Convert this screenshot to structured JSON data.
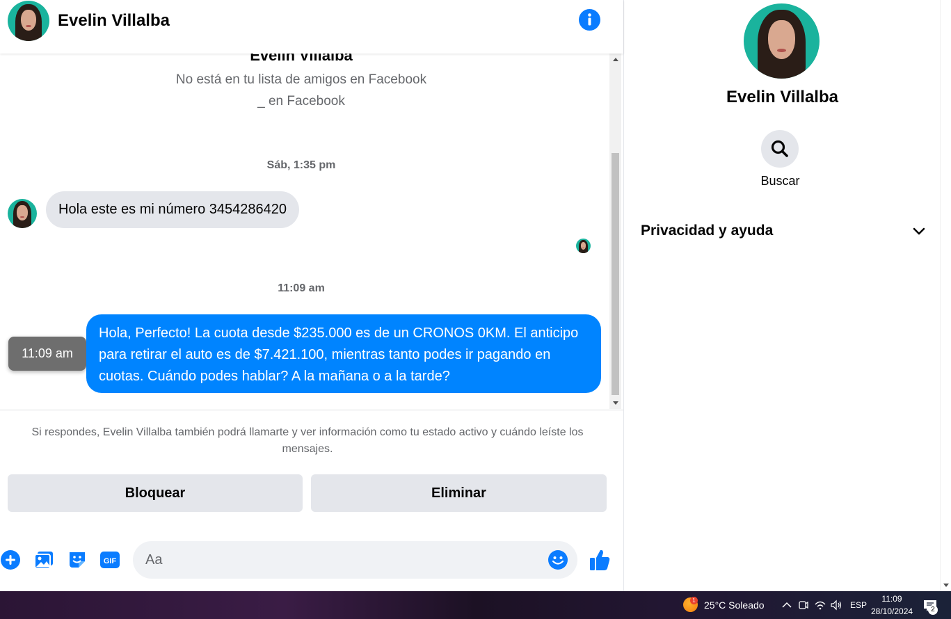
{
  "contact": {
    "name": "Evelin Villalba"
  },
  "intro": {
    "name": "Evelin Villalba",
    "line1": "No está en tu lista de amigos en Facebook",
    "line2": "_ en Facebook"
  },
  "messages": [
    {
      "timestamp": "Sáb, 1:35 pm",
      "direction": "incoming",
      "text": "Hola este es mi número 3454286420"
    },
    {
      "timestamp": "11:09 am",
      "direction": "outgoing",
      "text": "Hola, Perfecto! La cuota desde $235.000 es de un CRONOS 0KM. El anticipo para retirar el auto es de $7.421.100, mientras tanto podes ir pagando en cuotas. Cuándo podes hablar? A la mañana o a la tarde?",
      "tooltip": "11:09 am"
    }
  ],
  "notice": "Si respondes, Evelin Villalba también podrá llamarte y ver información como tu estado activo y cuándo leíste los mensajes.",
  "actions": {
    "block": "Bloquear",
    "delete": "Eliminar"
  },
  "composer": {
    "placeholder": "Aa",
    "icons": [
      "plus-icon",
      "photo-icon",
      "sticker-icon",
      "gif-icon",
      "emoji-icon",
      "thumbs-up-icon"
    ],
    "gif_label": "GIF"
  },
  "side_panel": {
    "name": "Evelin Villalba",
    "search_label": "Buscar",
    "privacy_label": "Privacidad y ayuda"
  },
  "taskbar": {
    "weather_badge": "1",
    "weather": "25°C  Soleado",
    "language": "ESP",
    "time": "11:09",
    "date": "28/10/2024",
    "notification_count": "2"
  },
  "colors": {
    "accent": "#0084ff",
    "icon_blue": "#0a7cff",
    "bubble_gray": "#e4e6eb"
  }
}
